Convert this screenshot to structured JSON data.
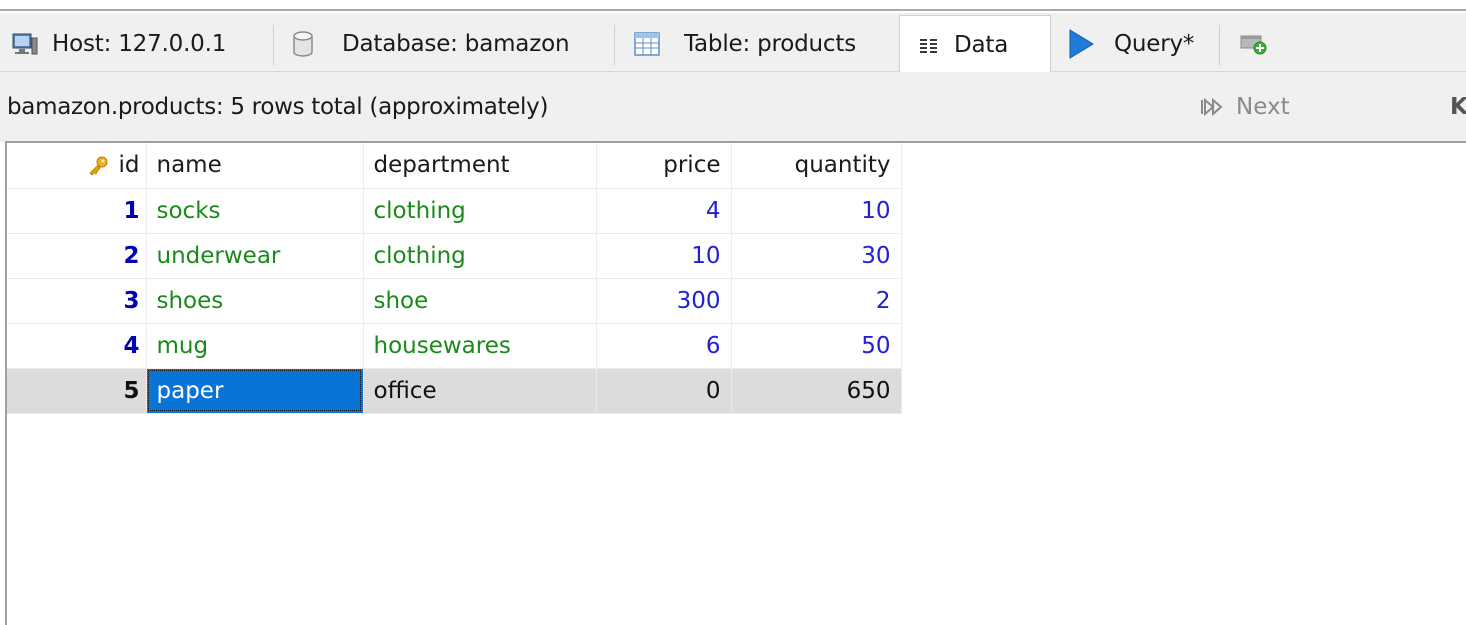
{
  "tabs": [
    {
      "id": "host",
      "label": "Host: 127.0.0.1",
      "icon": "server-icon"
    },
    {
      "id": "database",
      "label": "Database: bamazon",
      "icon": "database-icon"
    },
    {
      "id": "table",
      "label": "Table: products",
      "icon": "table-icon"
    },
    {
      "id": "data",
      "label": "Data",
      "icon": "data-grid-icon",
      "active": true
    },
    {
      "id": "query",
      "label": "Query*",
      "icon": "play-icon"
    },
    {
      "id": "new-query",
      "label": "",
      "icon": "new-query-tab-icon"
    }
  ],
  "info": {
    "row_count_text": "bamazon.products: 5 rows total (approximately)",
    "next_label": "Next",
    "edge_char": "K"
  },
  "grid": {
    "columns": [
      "id",
      "name",
      "department",
      "price",
      "quantity"
    ],
    "rows": [
      {
        "id": "1",
        "name": "socks",
        "department": "clothing",
        "price": "4",
        "quantity": "10"
      },
      {
        "id": "2",
        "name": "underwear",
        "department": "clothing",
        "price": "10",
        "quantity": "30"
      },
      {
        "id": "3",
        "name": "shoes",
        "department": "shoe",
        "price": "300",
        "quantity": "2"
      },
      {
        "id": "4",
        "name": "mug",
        "department": "housewares",
        "price": "6",
        "quantity": "50"
      },
      {
        "id": "5",
        "name": "paper",
        "department": "office",
        "price": "0",
        "quantity": "650"
      }
    ],
    "selected_row_index": 4,
    "focused_column": "name"
  },
  "colors": {
    "text_green": "#1a8a1a",
    "number_blue": "#2020d8",
    "id_blue": "#0000b4",
    "selection_blue": "#0a74d6",
    "selected_row_gray": "#dcdcdc",
    "key_icon_gold": "#e8a000"
  }
}
